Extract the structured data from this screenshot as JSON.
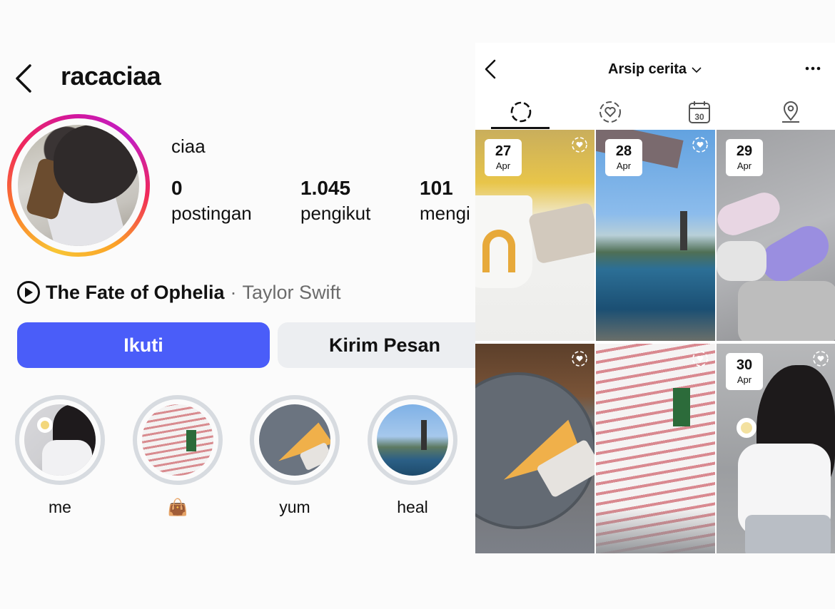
{
  "profile": {
    "username": "racaciaa",
    "display_name": "ciaa",
    "stats": [
      {
        "value": "0",
        "label": "postingan"
      },
      {
        "value": "1.045",
        "label": "pengikut"
      },
      {
        "value": "101",
        "label": "mengi"
      }
    ],
    "song": {
      "title": "The Fate of Ophelia",
      "separator": "·",
      "artist": "Taylor Swift"
    },
    "follow_label": "Ikuti",
    "message_label": "Kirim Pesan",
    "highlights": [
      {
        "label": "me"
      },
      {
        "label": "👜"
      },
      {
        "label": "yum"
      },
      {
        "label": "heal"
      }
    ]
  },
  "archive": {
    "title": "Arsip cerita",
    "tabs": [
      "stories-archive-icon",
      "highlight-heart-icon",
      "calendar-icon",
      "location-pin-icon"
    ],
    "calendar_icon_text": "30",
    "items": [
      {
        "day": "27",
        "month": "Apr"
      },
      {
        "day": "28",
        "month": "Apr"
      },
      {
        "day": "29",
        "month": "Apr"
      },
      {
        "day": "",
        "month": ""
      },
      {
        "day": "",
        "month": ""
      },
      {
        "day": "30",
        "month": "Apr"
      }
    ]
  },
  "colors": {
    "follow_button": "#4a5df9",
    "message_button": "#eceef1",
    "secondary_text": "#6b6b6b"
  }
}
